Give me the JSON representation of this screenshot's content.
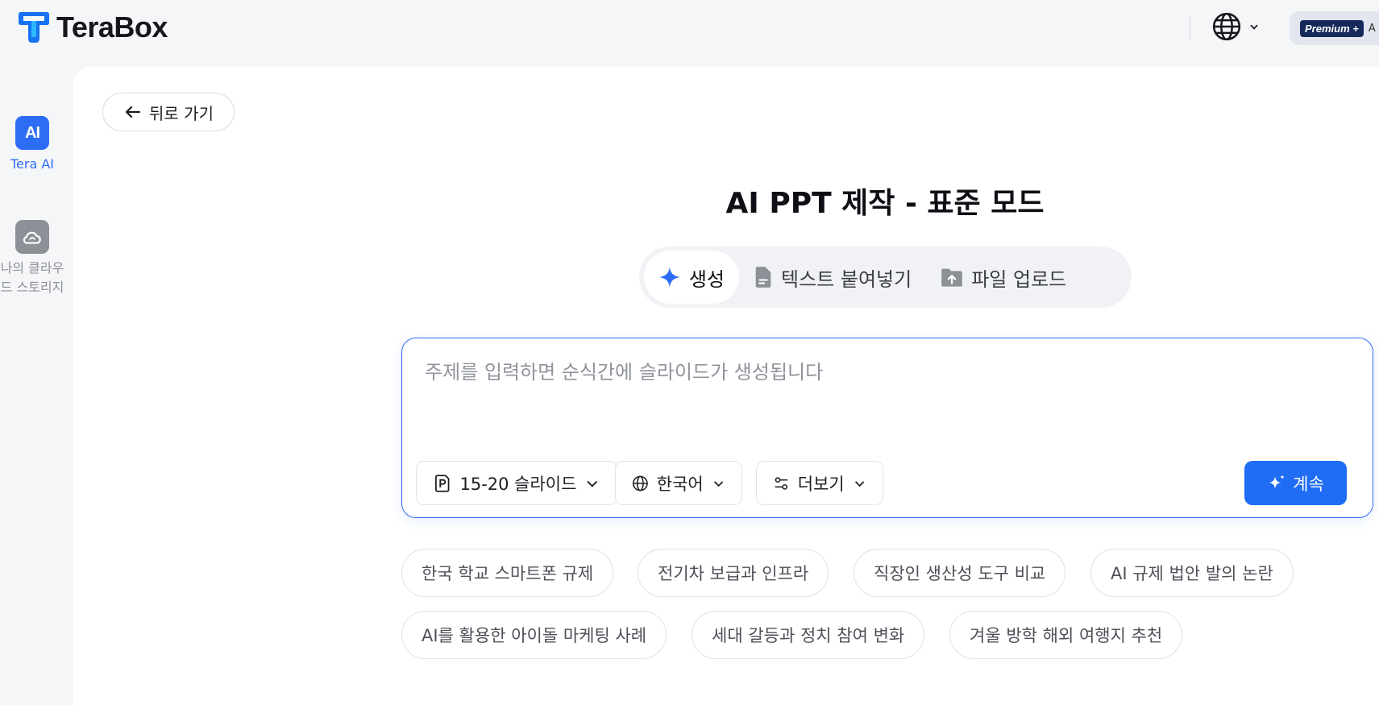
{
  "app": {
    "brand": "TeraBox",
    "premium_badge": "Premium +",
    "premium_tail": "A"
  },
  "sidebar": {
    "items": [
      {
        "label": "Tera AI",
        "icon": "ai-icon",
        "active": true,
        "icon_text": "AI"
      },
      {
        "label": "나의 클라우드 스토리지",
        "icon": "cloud-icon",
        "active": false
      }
    ]
  },
  "main": {
    "back_label": "뒤로 가기",
    "title": "AI PPT 제작 - 표준 모드",
    "tabs": [
      {
        "label": "생성",
        "icon": "sparkle-icon",
        "active": true
      },
      {
        "label": "텍스트 붙여넣기",
        "icon": "document-icon",
        "active": false
      },
      {
        "label": "파일 업로드",
        "icon": "folder-upload-icon",
        "active": false
      }
    ],
    "composer": {
      "placeholder": "주제를 입력하면 순식간에 슬라이드가 생성됩니다",
      "value": "",
      "slides_option": "15-20 슬라이드",
      "language_option": "한국어",
      "more_option": "더보기",
      "continue_label": "계속"
    },
    "suggestions": [
      "한국 학교 스마트폰 규제",
      "전기차 보급과 인프라",
      "직장인 생산성 도구 비교",
      "AI 규제 법안 발의 논란",
      "AI를 활용한 아이돌 마케팅 사례",
      "세대 갈등과 정치 참여 변화",
      "겨울 방학 해외 여행지 추천"
    ]
  },
  "colors": {
    "accent": "#1f6cf5",
    "logo": "#1673f2",
    "sidebar_active": "#2d6df6",
    "sidebar_inactive": "#8d9097",
    "premium_badge_bg": "#16295a"
  }
}
